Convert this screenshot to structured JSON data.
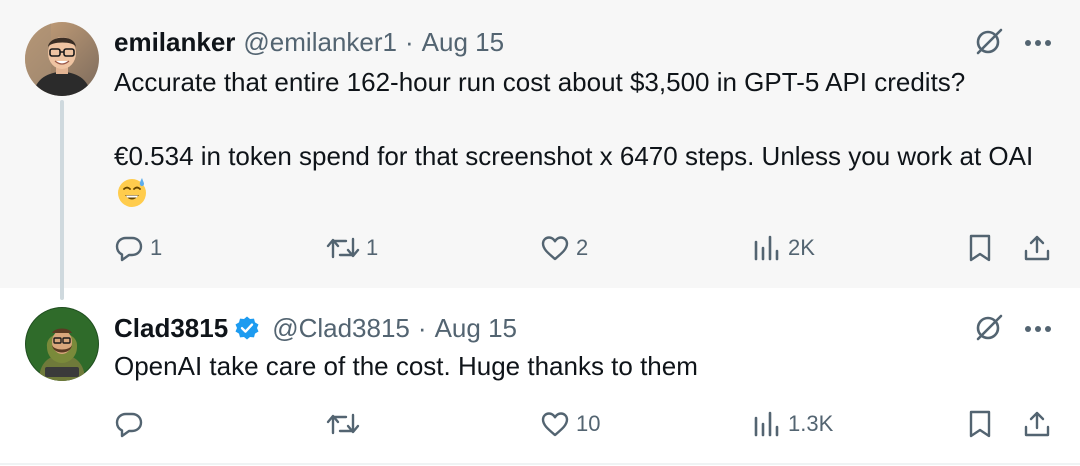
{
  "tweets": [
    {
      "display_name": "emilanker",
      "handle": "@emilanker1",
      "separator": "·",
      "date": "Aug 15",
      "verified": false,
      "text_lines": [
        "Accurate that entire 162-hour run cost about $3,500 in GPT-5 API credits?",
        "€0.534 in token spend for that screenshot x 6470 steps. Unless you work at OAI"
      ],
      "emoji": "sweat-smile",
      "reply_count": "1",
      "retweet_count": "1",
      "like_count": "2",
      "views_count": "2K"
    },
    {
      "display_name": "Clad3815",
      "handle": "@Clad3815",
      "separator": "·",
      "date": "Aug 15",
      "verified": true,
      "text_lines": [
        "OpenAI take care of the cost. Huge thanks to them"
      ],
      "reply_count": "",
      "retweet_count": "",
      "like_count": "10",
      "views_count": "1.3K"
    }
  ],
  "icons": [
    "grok-icon",
    "more-icon",
    "reply-icon",
    "retweet-icon",
    "like-icon",
    "views-icon",
    "bookmark-icon",
    "share-icon",
    "verified-badge-icon"
  ],
  "colors": {
    "text": "#0f1419",
    "muted": "#536471",
    "verified": "#1d9bf0",
    "highlight_bg": "#f7f7f7"
  }
}
